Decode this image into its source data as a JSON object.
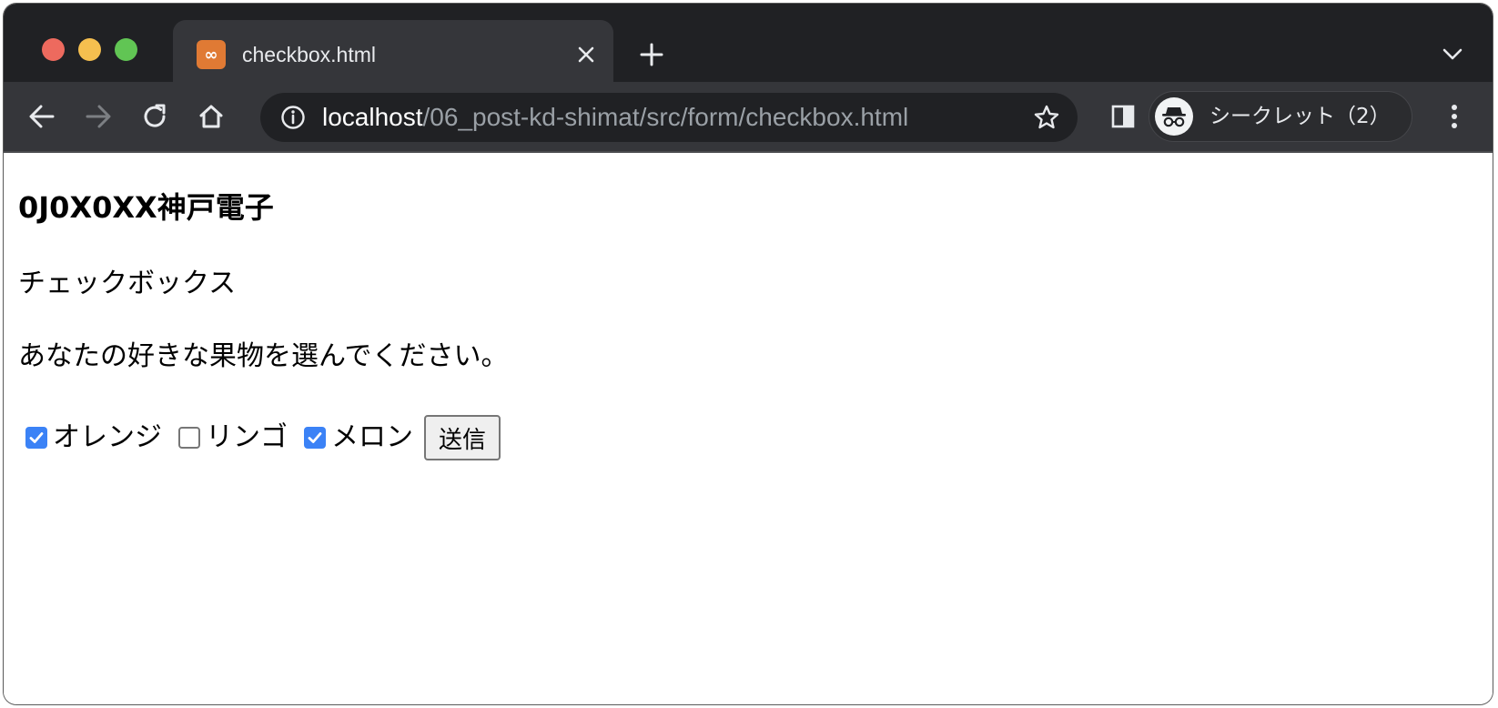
{
  "browser": {
    "tab": {
      "title": "checkbox.html",
      "favicon": "xampp-icon"
    },
    "address": {
      "host": "localhost",
      "path": "/06_post-kd-shimat/src/form/checkbox.html"
    },
    "profile": {
      "label": "シークレット（2）"
    },
    "colors": {
      "close": "#ed6a5e",
      "minimize": "#f5bf4f",
      "zoom": "#61c554",
      "checkbox_checked": "#3b82f6"
    }
  },
  "page": {
    "heading": "0J0X0XX神戸電子",
    "subtitle": "チェックボックス",
    "question": "あなたの好きな果物を選んでください。",
    "checkboxes": [
      {
        "label": "オレンジ",
        "checked": true
      },
      {
        "label": "リンゴ",
        "checked": false
      },
      {
        "label": "メロン",
        "checked": true
      }
    ],
    "submit_label": "送信"
  }
}
